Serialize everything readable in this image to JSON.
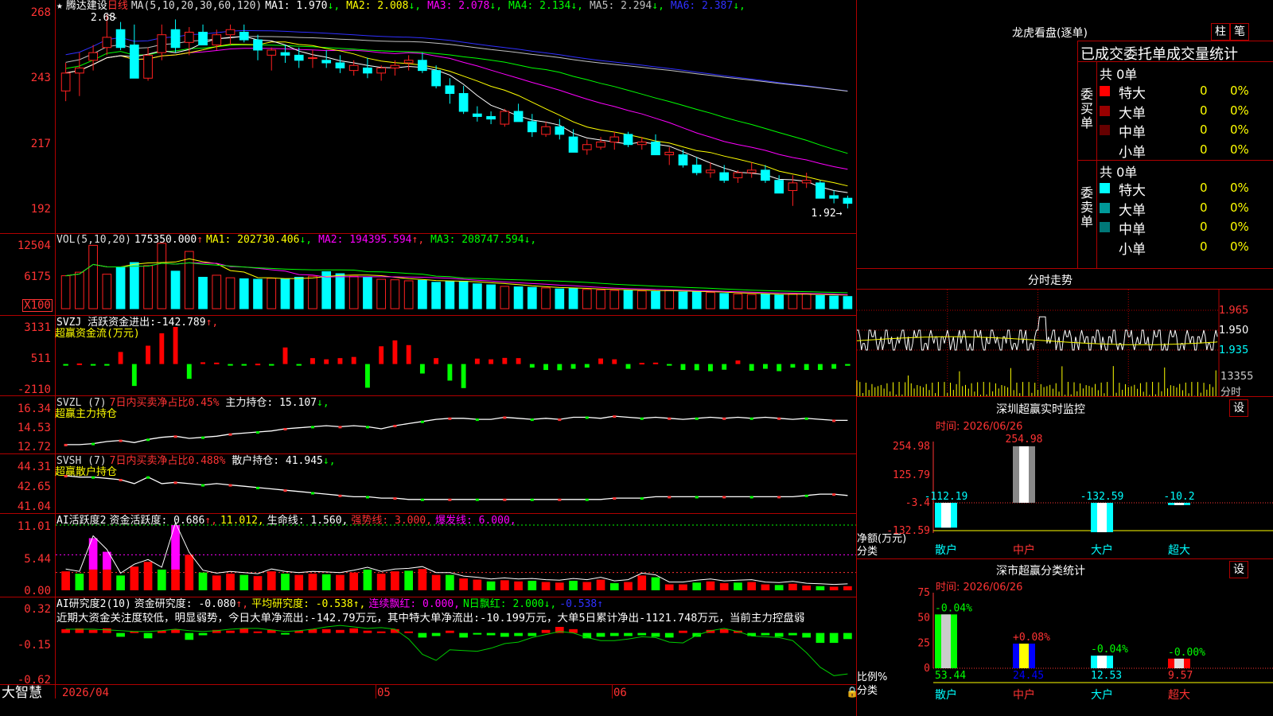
{
  "colors": {
    "up": "#ff2020",
    "down": "#00ffff",
    "grid": "#b00000",
    "axis": "#ff3333",
    "ma5": "#ffffff",
    "ma10": "#ffff00",
    "ma20": "#ff00ff",
    "ma30": "#00ff00",
    "ma60": "#c0c0c0",
    "ma120": "#3030ff"
  },
  "main": {
    "star": "★",
    "name": "腾达建设",
    "period": "日线",
    "ma_label": "MA(5,10,20,30,60,120)",
    "ma": [
      {
        "label": "MA1:",
        "value": "1.970",
        "arrow": "↓",
        "color": "#ffffff"
      },
      {
        "label": "MA2:",
        "value": "2.008",
        "arrow": "↓",
        "color": "#ffff00"
      },
      {
        "label": "MA3:",
        "value": "2.078",
        "arrow": "↓",
        "color": "#ff00ff"
      },
      {
        "label": "MA4:",
        "value": "2.134",
        "arrow": "↓",
        "color": "#00ff00"
      },
      {
        "label": "MA5:",
        "value": "2.294",
        "arrow": "↓",
        "color": "#c0c0c0"
      },
      {
        "label": "MA6:",
        "value": "2.387",
        "arrow": "↓",
        "color": "#3030ff"
      }
    ],
    "y_ticks": [
      "268",
      "243",
      "217",
      "192"
    ],
    "high_label": "2.68",
    "low_label": "1.92"
  },
  "vol": {
    "label": "VOL(5,10,20)",
    "value": "175350.000",
    "arrow": "↑",
    "ma": [
      {
        "label": "MA1:",
        "value": "202730.406",
        "arrow": "↓",
        "color": "#ffff00"
      },
      {
        "label": "MA2:",
        "value": "194395.594",
        "arrow": "↑",
        "color": "#ff00ff"
      },
      {
        "label": "MA3:",
        "value": "208747.594",
        "arrow": "↓",
        "color": "#00ff00"
      }
    ],
    "y_ticks": [
      "12504",
      "6175",
      "X100"
    ]
  },
  "svzj": {
    "line1": "SVZJ  活跃资金进出:",
    "value": "-142.789",
    "arrow": "↑,",
    "line2": "超赢资金流(万元)",
    "y_ticks": [
      "3131",
      "511",
      "-2110"
    ]
  },
  "svzl": {
    "name": "SVZL (7)",
    "desc": "7日内买卖净占比0.45%",
    "label": "主力持仓:",
    "value": "15.107",
    "arrow": "↓,",
    "line2": "超赢主力持仓",
    "y_ticks": [
      "16.34",
      "14.53",
      "12.72"
    ]
  },
  "svsh": {
    "name": "SVSH (7)",
    "desc": "7日内买卖净占比0.488%",
    "label": "散户持仓:",
    "value": "41.945",
    "arrow": "↓,",
    "line2": "超赢散户持仓",
    "y_ticks": [
      "44.31",
      "42.65",
      "41.04"
    ]
  },
  "ai1": {
    "name": "AI活跃度2",
    "label": "资金活跃度:",
    "value": "0.686",
    "arrow": "↑,",
    "v2": "11.012,",
    "life": "生命线: 1.560,",
    "strong": "强势线: 3.000,",
    "burst": "爆发线: 6.000,",
    "y_ticks": [
      "11.01",
      "5.44",
      "0.00"
    ]
  },
  "ai2": {
    "name": "AI研究度2(10)",
    "label": "资金研究度:",
    "value": "-0.080",
    "arrow": "↑,",
    "avg": "平均研究度: -0.538↑,",
    "red": "连续飘红: 0.000,",
    "nred": "N日飘红: 2.000↓,",
    "last": "-0.538↑",
    "comment": "近期大资金关注度较低，明显弱势，今日大单净流出:-142.79万元，其中特大单净流出:-10.199万元，大单5日累计净出-1121.748万元，当前主力控盘弱",
    "y_ticks": [
      "0.32",
      "-0.15",
      "-0.62"
    ]
  },
  "xaxis": {
    "labels": [
      "2026/04",
      "05",
      "06"
    ]
  },
  "brand": "大智慧",
  "right": {
    "title": "龙虎看盘(逐单)",
    "btn_bar": "柱",
    "btn_pen": "笔",
    "tabs": "已成交委托单成交量统计",
    "buy": {
      "side": "委买单",
      "total": "共 0单",
      "rows": [
        {
          "name": "特大",
          "count": "0",
          "pct": "0%",
          "color": "#ff0000"
        },
        {
          "name": "大单",
          "count": "0",
          "pct": "0%",
          "color": "#990000"
        },
        {
          "name": "中单",
          "count": "0",
          "pct": "0%",
          "color": "#660000"
        },
        {
          "name": "小单",
          "count": "0",
          "pct": "0%",
          "color": "#000000"
        }
      ]
    },
    "sell": {
      "side": "委卖单",
      "total": "共 0单",
      "rows": [
        {
          "name": "特大",
          "count": "0",
          "pct": "0%",
          "color": "#00ffff"
        },
        {
          "name": "大单",
          "count": "0",
          "pct": "0%",
          "color": "#009999"
        },
        {
          "name": "中单",
          "count": "0",
          "pct": "0%",
          "color": "#007777"
        },
        {
          "name": "小单",
          "count": "0",
          "pct": "0%",
          "color": "#000000"
        }
      ]
    },
    "intraday": {
      "title": "分时走势",
      "y_ticks": [
        "1.965",
        "1.950",
        "1.935"
      ],
      "vol_tick": "13355",
      "tag": "分时"
    },
    "sz_monitor": {
      "title": "深圳超赢实时监控",
      "btn": "设",
      "date": "时间: 2026/06/26",
      "y_ticks": [
        "254.98",
        "125.79",
        "-3.4",
        "-132.59"
      ],
      "ylabel": "净额(万元)",
      "xlabel": "分类",
      "categories": [
        "散户",
        "中户",
        "大户",
        "超大"
      ],
      "values": [
        -112.19,
        254.98,
        -132.59,
        -10.2
      ],
      "labels": [
        "-112.19",
        "254.98",
        "-132.59",
        "-10.2"
      ]
    },
    "sz_stats": {
      "title": "深市超赢分类统计",
      "btn": "设",
      "date": "时间: 2026/06/26",
      "y_ticks": [
        "75",
        "50",
        "25",
        "0"
      ],
      "ylabel": "比例%",
      "xlabel": "分类",
      "categories": [
        "散户",
        "中户",
        "大户",
        "超大"
      ],
      "values": [
        53.44,
        24.45,
        12.53,
        9.57
      ],
      "changes": [
        "-0.04%",
        "+0.08%",
        "-0.04%",
        "-0.00%"
      ]
    }
  },
  "chart_data": [
    {
      "type": "candlestick",
      "title": "腾达建设 日线",
      "ohlc": [
        [
          2.38,
          2.49,
          2.34,
          2.45
        ],
        [
          2.45,
          2.53,
          2.36,
          2.47
        ],
        [
          2.5,
          2.56,
          2.46,
          2.53
        ],
        [
          2.55,
          2.68,
          2.52,
          2.59
        ],
        [
          2.62,
          2.65,
          2.54,
          2.55
        ],
        [
          2.56,
          2.64,
          2.43,
          2.43
        ],
        [
          2.43,
          2.55,
          2.42,
          2.52
        ],
        [
          2.53,
          2.64,
          2.5,
          2.6
        ],
        [
          2.62,
          2.66,
          2.53,
          2.55
        ],
        [
          2.57,
          2.63,
          2.52,
          2.61
        ],
        [
          2.61,
          2.64,
          2.56,
          2.56
        ],
        [
          2.56,
          2.62,
          2.54,
          2.6
        ],
        [
          2.6,
          2.64,
          2.56,
          2.62
        ],
        [
          2.61,
          2.64,
          2.57,
          2.58
        ],
        [
          2.58,
          2.6,
          2.5,
          2.54
        ],
        [
          2.52,
          2.55,
          2.46,
          2.54
        ],
        [
          2.53,
          2.56,
          2.49,
          2.52
        ],
        [
          2.52,
          2.55,
          2.47,
          2.5
        ],
        [
          2.51,
          2.54,
          2.47,
          2.51
        ],
        [
          2.5,
          2.54,
          2.47,
          2.49
        ],
        [
          2.49,
          2.52,
          2.45,
          2.47
        ],
        [
          2.46,
          2.5,
          2.44,
          2.48
        ],
        [
          2.47,
          2.51,
          2.43,
          2.45
        ],
        [
          2.45,
          2.48,
          2.42,
          2.47
        ],
        [
          2.47,
          2.5,
          2.44,
          2.48
        ],
        [
          2.49,
          2.52,
          2.46,
          2.5
        ],
        [
          2.5,
          2.53,
          2.45,
          2.46
        ],
        [
          2.46,
          2.48,
          2.39,
          2.4
        ],
        [
          2.4,
          2.43,
          2.33,
          2.37
        ],
        [
          2.37,
          2.4,
          2.29,
          2.3
        ],
        [
          2.29,
          2.32,
          2.26,
          2.28
        ],
        [
          2.28,
          2.3,
          2.25,
          2.27
        ],
        [
          2.25,
          2.31,
          2.24,
          2.3
        ],
        [
          2.3,
          2.33,
          2.26,
          2.26
        ],
        [
          2.26,
          2.29,
          2.2,
          2.22
        ],
        [
          2.21,
          2.26,
          2.2,
          2.24
        ],
        [
          2.24,
          2.27,
          2.19,
          2.21
        ],
        [
          2.2,
          2.23,
          2.14,
          2.14
        ],
        [
          2.15,
          2.19,
          2.13,
          2.17
        ],
        [
          2.16,
          2.2,
          2.15,
          2.18
        ],
        [
          2.18,
          2.22,
          2.15,
          2.2
        ],
        [
          2.21,
          2.22,
          2.16,
          2.17
        ],
        [
          2.17,
          2.2,
          2.15,
          2.18
        ],
        [
          2.18,
          2.21,
          2.13,
          2.13
        ],
        [
          2.13,
          2.16,
          2.09,
          2.14
        ],
        [
          2.13,
          2.15,
          2.08,
          2.09
        ],
        [
          2.09,
          2.12,
          2.05,
          2.06
        ],
        [
          2.06,
          2.1,
          2.04,
          2.07
        ],
        [
          2.06,
          2.09,
          2.02,
          2.03
        ],
        [
          2.04,
          2.07,
          2.02,
          2.06
        ],
        [
          2.06,
          2.1,
          2.04,
          2.07
        ],
        [
          2.07,
          2.09,
          2.02,
          2.03
        ],
        [
          2.03,
          2.05,
          1.98,
          1.98
        ],
        [
          1.99,
          2.05,
          1.93,
          2.02
        ],
        [
          2.02,
          2.06,
          2.0,
          2.03
        ],
        [
          2.02,
          2.03,
          1.96,
          1.96
        ],
        [
          1.97,
          1.99,
          1.94,
          1.96
        ],
        [
          1.96,
          1.97,
          1.92,
          1.94
        ]
      ],
      "ylim": [
        1.92,
        2.68
      ],
      "y_ticks": [
        "268",
        "243",
        "217",
        "192"
      ]
    },
    {
      "type": "bar",
      "title": "VOL(5,10,20)",
      "values": [
        6500,
        7200,
        12500,
        6800,
        8200,
        9100,
        8500,
        12900,
        7400,
        11300,
        6200,
        6600,
        6100,
        5900,
        5800,
        6000,
        5900,
        6200,
        6400,
        7300,
        6900,
        6400,
        6200,
        5800,
        5700,
        5500,
        5600,
        5200,
        5400,
        5400,
        4900,
        4700,
        4400,
        4300,
        4200,
        4100,
        3900,
        4000,
        3800,
        3700,
        3600,
        3600,
        3500,
        3400,
        3600,
        3300,
        3300,
        3200,
        3000,
        2900,
        2800,
        2900,
        2700,
        2900,
        3000,
        2600,
        2500,
        2400
      ],
      "y_ticks": [
        "12504",
        "6175"
      ]
    },
    {
      "type": "bar",
      "title": "SVZJ 活跃资金进出",
      "values": [
        -60,
        50,
        -60,
        -80,
        1020,
        -1850,
        1550,
        2600,
        3130,
        -1250,
        150,
        120,
        -50,
        -40,
        30,
        -20,
        1400,
        -30,
        500,
        400,
        500,
        600,
        -2000,
        1500,
        2000,
        1600,
        -800,
        500,
        -1400,
        -2030,
        460,
        400,
        520,
        500,
        -300,
        -500,
        -520,
        -400,
        -300,
        470,
        400,
        -400,
        100,
        120,
        -100,
        -500,
        -520,
        -600,
        -480,
        300,
        -560,
        -400,
        -600,
        -300,
        -500,
        -500,
        -400,
        -142.789
      ],
      "y_ticks": [
        "3131",
        "511",
        "-2110"
      ]
    },
    {
      "type": "line",
      "title": "SVZL 主力持仓",
      "values": [
        12.8,
        12.8,
        12.9,
        13.1,
        13.2,
        13.0,
        13.3,
        13.5,
        13.6,
        13.4,
        13.5,
        13.6,
        13.8,
        13.9,
        14.0,
        14.1,
        14.3,
        14.4,
        14.5,
        14.6,
        14.5,
        14.6,
        14.5,
        14.3,
        14.6,
        14.8,
        15.0,
        15.2,
        15.3,
        15.3,
        15.2,
        15.2,
        15.4,
        15.3,
        15.2,
        15.3,
        15.2,
        15.4,
        15.4,
        15.3,
        15.5,
        15.4,
        15.3,
        15.4,
        15.3,
        15.2,
        15.3,
        15.4,
        15.3,
        15.4,
        15.3,
        15.4,
        15.3,
        15.2,
        15.3,
        15.2,
        15.1,
        15.1
      ],
      "y_ticks": [
        "16.34",
        "14.53",
        "12.72"
      ]
    },
    {
      "type": "line",
      "title": "SVSH 散户持仓",
      "values": [
        43.4,
        43.3,
        43.3,
        43.2,
        43.1,
        42.8,
        43.3,
        42.8,
        42.9,
        42.8,
        42.7,
        42.8,
        42.7,
        42.6,
        42.5,
        42.4,
        42.3,
        42.2,
        42.1,
        42.0,
        41.9,
        41.8,
        41.8,
        41.7,
        41.7,
        41.6,
        41.6,
        41.6,
        41.6,
        41.6,
        41.6,
        41.6,
        41.6,
        41.6,
        41.6,
        41.6,
        41.6,
        41.6,
        41.6,
        41.6,
        41.7,
        41.7,
        41.7,
        41.8,
        41.8,
        41.8,
        41.8,
        41.8,
        41.8,
        41.8,
        41.8,
        41.8,
        41.8,
        41.8,
        41.9,
        42.0,
        42.0,
        41.9
      ],
      "y_ticks": [
        "44.31",
        "42.65",
        "41.04"
      ]
    },
    {
      "type": "bar",
      "title": "AI活跃度2 资金活跃度",
      "values": [
        3.2,
        2.8,
        8.8,
        6.5,
        2.5,
        4.0,
        4.8,
        3.5,
        11.0,
        6.0,
        3.0,
        2.5,
        2.8,
        2.6,
        2.4,
        3.2,
        2.8,
        2.6,
        2.8,
        2.7,
        2.6,
        3.0,
        3.5,
        2.8,
        3.2,
        3.3,
        3.6,
        2.6,
        2.6,
        2.0,
        1.8,
        1.5,
        1.7,
        1.5,
        1.6,
        1.4,
        1.3,
        1.6,
        1.4,
        1.8,
        1.2,
        1.4,
        2.5,
        2.2,
        1.0,
        1.0,
        1.3,
        1.5,
        1.2,
        1.3,
        1.4,
        1.0,
        0.9,
        1.1,
        0.8,
        0.7,
        0.6,
        0.69
      ],
      "ylim": [
        0,
        11.01
      ],
      "lines": {
        "生命线": 1.56,
        "强势线": 3.0,
        "爆发线": 6.0
      }
    },
    {
      "type": "bar",
      "title": "AI研究度2 资金研究度",
      "values": [
        0.05,
        0.06,
        0.04,
        0.06,
        -0.05,
        0.02,
        -0.07,
        0.03,
        0.05,
        -0.09,
        -0.03,
        0.04,
        0.03,
        0.06,
        0.02,
        0.04,
        -0.02,
        0.03,
        0.05,
        0.05,
        0.04,
        0.06,
        0.03,
        0.02,
        0.05,
        0.02,
        -0.06,
        -0.04,
        0.03,
        -0.06,
        -0.02,
        -0.03,
        -0.05,
        -0.04,
        -0.04,
        0.04,
        0.08,
        0.05,
        -0.07,
        -0.05,
        -0.04,
        -0.04,
        -0.03,
        -0.05,
        -0.06,
        0.03,
        -0.05,
        0.04,
        0.05,
        0.03,
        -0.04,
        -0.03,
        -0.05,
        -0.03,
        -0.06,
        -0.13,
        -0.13,
        -0.08
      ],
      "line": [
        0.05,
        0.05,
        0.05,
        0.04,
        0.03,
        0.02,
        0.02,
        0.03,
        0.05,
        0.03,
        0.02,
        0.03,
        0.05,
        0.06,
        0.06,
        0.04,
        0.02,
        0.03,
        0.05,
        0.08,
        0.1,
        0.08,
        0.06,
        0.07,
        0.05,
        -0.08,
        -0.28,
        -0.36,
        -0.22,
        -0.23,
        -0.24,
        -0.2,
        -0.14,
        -0.12,
        -0.06,
        -0.02,
        0.02,
        0.0,
        -0.06,
        -0.1,
        -0.1,
        -0.08,
        -0.05,
        -0.06,
        -0.12,
        -0.13,
        -0.03,
        0.03,
        0.06,
        0.02,
        -0.04,
        -0.05,
        -0.06,
        -0.1,
        -0.26,
        -0.45,
        -0.56,
        -0.538
      ],
      "y_ticks": [
        "0.32",
        "-0.15",
        "-0.62"
      ]
    }
  ]
}
